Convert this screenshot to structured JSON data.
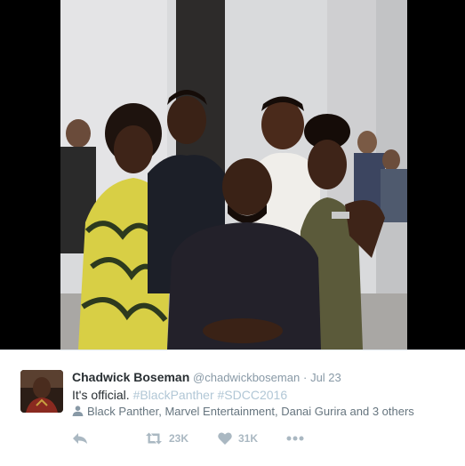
{
  "colors": {
    "background": "#000000",
    "card": "#ffffff",
    "name": "#292f33",
    "muted": "#8899a6",
    "hashtag": "#b1c7d6",
    "action_icon": "#aab8c2"
  },
  "tweet": {
    "display_name": "Chadwick Boseman",
    "handle": "@chadwickboseman",
    "separator": "·",
    "date": "Jul 23",
    "text_prefix": "It's official.",
    "hashtag_1": "#BlackPanther",
    "hashtag_2": "#SDCC2016",
    "tagged_people": "Black Panther, Marvel Entertainment, Danai Gurira and 3 others"
  },
  "actions": {
    "reply_icon": "reply-icon",
    "retweet_icon": "retweet-icon",
    "retweet_count": "23K",
    "like_icon": "heart-icon",
    "like_count": "31K",
    "more_icon": "more-icon"
  }
}
